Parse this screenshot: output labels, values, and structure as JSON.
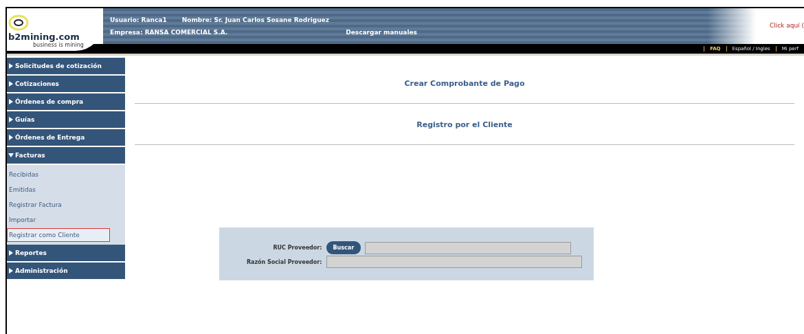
{
  "header": {
    "logo": "b2mining.com",
    "tagline": "business is mining",
    "user": "Usuario: Ranca1",
    "name": "Nombre: Sr. Juan Carlos Sosane Rodriguez",
    "company": "Empresa: RANSA COMERCIAL S.A.",
    "manuals_link": "Descargar manuales",
    "click_link": "Click aquí (",
    "nav": [
      {
        "label": "FAQ",
        "selected": true
      },
      {
        "label": "Español / Ingles",
        "selected": false
      },
      {
        "label": "Mi perf",
        "selected": false
      }
    ]
  },
  "sidebar": {
    "items": [
      {
        "label": "Solicitudes de cotización",
        "expanded": false
      },
      {
        "label": "Cotizaciones",
        "expanded": false
      },
      {
        "label": "Órdenes de compra",
        "expanded": false
      },
      {
        "label": "Guías",
        "expanded": false
      },
      {
        "label": "Órdenes de Entrega",
        "expanded": false
      },
      {
        "label": "Facturas",
        "expanded": true,
        "children": [
          {
            "label": "Recibidas",
            "selected": false
          },
          {
            "label": "Emitidas",
            "selected": false
          },
          {
            "label": "Registrar Factura",
            "selected": false
          },
          {
            "label": "Importar",
            "selected": false
          },
          {
            "label": "Registrar como Cliente",
            "selected": true
          }
        ]
      },
      {
        "label": "Reportes",
        "expanded": false
      },
      {
        "label": "Administración",
        "expanded": false
      }
    ]
  },
  "main": {
    "title": "Crear Comprobante de Pago",
    "subtitle": "Registro por el Cliente",
    "form": {
      "ruc_label": "RUC Proveedor:",
      "search_button": "Buscar",
      "name_label": "Razón Social Proveedor:"
    }
  }
}
